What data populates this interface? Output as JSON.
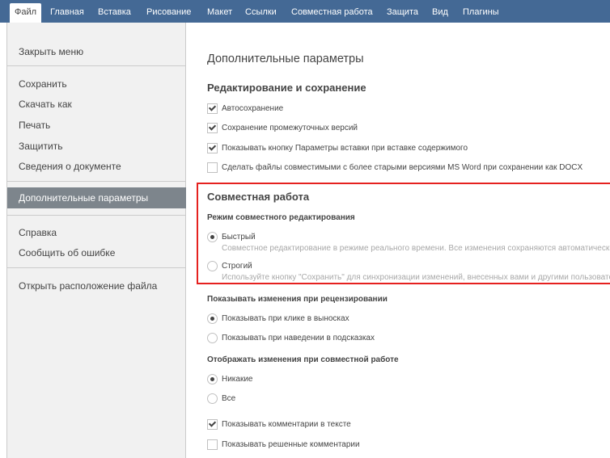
{
  "menu_tabs": [
    "Файл",
    "Главная",
    "Вставка",
    "Рисование",
    "Макет",
    "Ссылки",
    "Совместная работа",
    "Защита",
    "Вид",
    "Плагины"
  ],
  "sidebar": {
    "close_menu": "Закрыть меню",
    "save": "Сохранить",
    "download_as": "Скачать как",
    "print": "Печать",
    "protect": "Защитить",
    "doc_info": "Сведения о документе",
    "advanced": "Дополнительные параметры",
    "help": "Справка",
    "report_bug": "Сообщить об ошибке",
    "open_location": "Открыть расположение файла"
  },
  "main": {
    "title": "Дополнительные параметры",
    "editing": {
      "heading": "Редактирование и сохранение",
      "autosave": {
        "label": "Автосохранение",
        "checked": true
      },
      "interim_versions": {
        "label": "Сохранение промежуточных версий",
        "checked": true
      },
      "paste_button": {
        "label": "Показывать кнопку Параметры вставки при вставке содержимого",
        "checked": true
      },
      "compat": {
        "label": "Сделать файлы совместимыми с более старыми версиями MS Word при сохранении как DOCX",
        "checked": false
      }
    },
    "collab": {
      "heading": "Совместная работа",
      "mode_heading": "Режим совместного редактирования",
      "fast": {
        "label": "Быстрый",
        "desc": "Совместное редактирование в режиме реального времени. Все изменения сохраняются автоматически",
        "selected": true
      },
      "strict": {
        "label": "Строгий",
        "desc": "Используйте кнопку \"Сохранить\" для синхронизации изменений, внесенных вами и другими пользователями",
        "selected": false
      }
    },
    "review": {
      "heading": "Показывать изменения при рецензировании",
      "on_click": {
        "label": "Показывать при клике в выносках",
        "selected": true
      },
      "on_hover": {
        "label": "Показывать при наведении в подсказках",
        "selected": false
      }
    },
    "display_changes": {
      "heading": "Отображать изменения при совместной работе",
      "none": {
        "label": "Никакие",
        "selected": true
      },
      "all": {
        "label": "Все",
        "selected": false
      }
    },
    "comments": {
      "in_text": {
        "label": "Показывать комментарии в тексте",
        "checked": true
      },
      "resolved": {
        "label": "Показывать решенные комментарии",
        "checked": false
      }
    }
  },
  "colors": {
    "topbar": "#446995",
    "sidebar_active": "#7d858c",
    "highlight": "#e5211f"
  }
}
